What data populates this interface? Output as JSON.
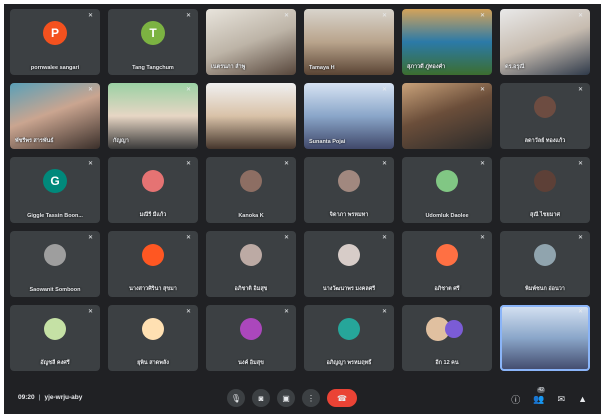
{
  "tiles": [
    {
      "type": "avatar",
      "initial": "P",
      "color": "#f4511e",
      "name": "pornwalee sangari"
    },
    {
      "type": "avatar",
      "initial": "T",
      "color": "#7cb342",
      "name": "Tang Tangchum"
    },
    {
      "type": "video",
      "name": "เนตรนภา ลำพู"
    },
    {
      "type": "video",
      "name": "Tamaya H"
    },
    {
      "type": "video",
      "name": "สุภาวดี ภู่ทองคำ"
    },
    {
      "type": "video",
      "name": "ดร.อรุณี"
    },
    {
      "type": "video",
      "name": "พัชรีพร สารพันธ์"
    },
    {
      "type": "video",
      "name": "กัญญา"
    },
    {
      "type": "video",
      "name": ""
    },
    {
      "type": "video",
      "name": "Sunanta Pojai"
    },
    {
      "type": "video",
      "name": ""
    },
    {
      "type": "avatar",
      "photo": true,
      "color": "#6d4c41",
      "name": "ลดาวัลย์ ทองแก้ว"
    },
    {
      "type": "avatar",
      "initial": "G",
      "color": "#00897b",
      "name": "Giggle Tassin Boon..."
    },
    {
      "type": "avatar",
      "photo": true,
      "color": "#e57373",
      "name": "มณีรี มีแก้ว"
    },
    {
      "type": "avatar",
      "photo": true,
      "color": "#8d6e63",
      "name": "Kanoka K"
    },
    {
      "type": "avatar",
      "photo": true,
      "color": "#a1887f",
      "name": "จิดาภา พรหมทา"
    },
    {
      "type": "avatar",
      "photo": true,
      "color": "#81c784",
      "name": "Udomluk Daolee"
    },
    {
      "type": "avatar",
      "photo": true,
      "color": "#5d4037",
      "name": "สุณี ไชยมาศ"
    },
    {
      "type": "avatar",
      "photo": true,
      "color": "#9e9e9e",
      "name": "Saowanit Somboon"
    },
    {
      "type": "avatar",
      "photo": true,
      "color": "#ff5722",
      "name": "นางสาวศิรินา สุขมา"
    },
    {
      "type": "avatar",
      "photo": true,
      "color": "#bcaaa4",
      "name": "อภิชาติ อิ่มสุข"
    },
    {
      "type": "avatar",
      "photo": true,
      "color": "#d7ccc8",
      "name": "นางวัฒนาพร มงคลศรี"
    },
    {
      "type": "avatar",
      "photo": true,
      "color": "#ff7043",
      "name": "อภิชาต ศรี"
    },
    {
      "type": "avatar",
      "photo": true,
      "color": "#90a4ae",
      "name": "พิมพ์ชนก อ่อนวา"
    },
    {
      "type": "avatar",
      "photo": true,
      "color": "#c5e1a5",
      "name": "อัญชลี คงศรี"
    },
    {
      "type": "avatar",
      "photo": true,
      "color": "#ffe0b2",
      "name": "ยุพิน สาดพลัง"
    },
    {
      "type": "avatar",
      "photo": true,
      "color": "#ab47bc",
      "name": "นงค์ อิ่มสุข"
    },
    {
      "type": "avatar",
      "photo": true,
      "color": "#26a69a",
      "name": "อภิญญา พรหมฤทธิ์"
    },
    {
      "type": "group",
      "color": "#e0c0a0",
      "name": "อีก 12 คน"
    },
    {
      "type": "video",
      "selected": true,
      "name": ""
    }
  ],
  "meeting": {
    "time": "09:20",
    "separator": "|",
    "code": "yje-wrju-aby"
  },
  "controls": [
    {
      "name": "mic-button",
      "icon": "microphone-icon",
      "glyph": "🎙"
    },
    {
      "name": "camera-button",
      "icon": "camera-icon",
      "glyph": "◙"
    },
    {
      "name": "present-button",
      "icon": "present-screen-icon",
      "glyph": "▣"
    },
    {
      "name": "more-options-button",
      "icon": "more-vertical-icon",
      "glyph": "⋮"
    },
    {
      "name": "leave-call-button",
      "icon": "hang-up-icon",
      "glyph": "☎"
    }
  ],
  "side_controls": [
    {
      "name": "info-button",
      "icon": "info-icon",
      "glyph": "ⓘ",
      "count": ""
    },
    {
      "name": "people-button",
      "icon": "people-icon",
      "glyph": "👥",
      "count": "42"
    },
    {
      "name": "chat-button",
      "icon": "chat-icon",
      "glyph": "✉",
      "count": ""
    },
    {
      "name": "activities-button",
      "icon": "shapes-icon",
      "glyph": "▲",
      "count": ""
    }
  ],
  "colors": {
    "background": "#202124",
    "tile": "#3c4043",
    "end_call": "#ea4335",
    "selected_border": "#8ab4f8"
  }
}
